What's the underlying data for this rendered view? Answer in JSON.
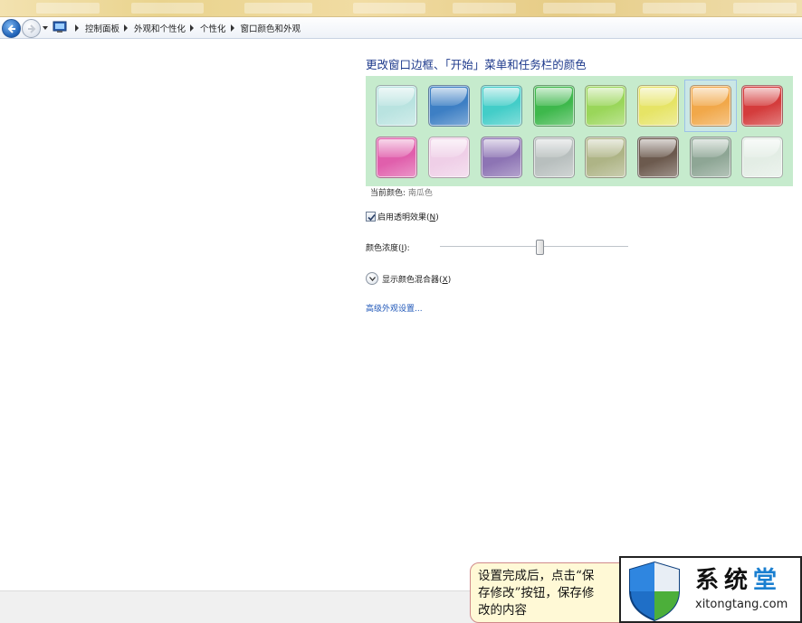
{
  "address_bar": {
    "crumbs": [
      "控制面板",
      "外观和个性化",
      "个性化",
      "窗口颜色和外观"
    ]
  },
  "main": {
    "title": "更改窗口边框、「开始」菜单和任务栏的颜色",
    "swatches": [
      {
        "name": "sky",
        "color": "#b9e3e0"
      },
      {
        "name": "twilight",
        "color": "#3d7fc4"
      },
      {
        "name": "sea",
        "color": "#43cdc8"
      },
      {
        "name": "leaf",
        "color": "#3eb84c"
      },
      {
        "name": "lime",
        "color": "#9ad65a"
      },
      {
        "name": "lightning",
        "color": "#e6e466"
      },
      {
        "name": "pumpkin",
        "color": "#f1a84a"
      },
      {
        "name": "ruby",
        "color": "#d43c3c"
      },
      {
        "name": "fuchsia",
        "color": "#e05fac"
      },
      {
        "name": "blush",
        "color": "#efcfe7"
      },
      {
        "name": "violet",
        "color": "#8d74b4"
      },
      {
        "name": "lavender",
        "color": "#b8bfbe"
      },
      {
        "name": "taupe",
        "color": "#aeb486"
      },
      {
        "name": "chocolate",
        "color": "#6c5a4e"
      },
      {
        "name": "slate",
        "color": "#8ea695"
      },
      {
        "name": "frost",
        "color": "#e3ede5"
      }
    ],
    "selected_index": 6,
    "current_color_label": "当前颜色:",
    "current_color_value": "南瓜色",
    "transparency_label": "启用透明效果(",
    "transparency_key": "N",
    "transparency_close": ")",
    "transparency_checked": true,
    "intensity_label": "颜色浓度(",
    "intensity_key": "I",
    "intensity_close": "):",
    "intensity_level": 0.53,
    "mixer_label": "显示颜色混合器(",
    "mixer_key": "X",
    "mixer_close": ")",
    "advanced_link": "高级外观设置..."
  },
  "callout": {
    "lines": [
      "设置完成后，点击“保",
      "存修改”按钮，保存修",
      "改的内容"
    ]
  },
  "logo": {
    "title_part1": "系统",
    "title_part2": "堂",
    "url": "xitongtang.com"
  },
  "colors": {
    "title_blue": "#1e3a8c",
    "link_blue": "#1f57b8",
    "panel_green": "#c6ebcd",
    "logo_accent": "#1a7fd0"
  }
}
